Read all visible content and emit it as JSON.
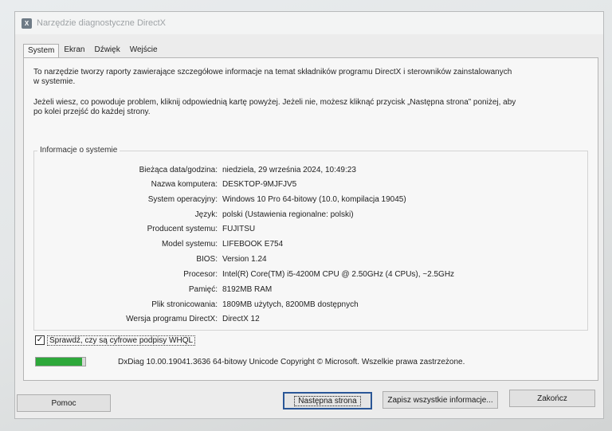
{
  "window": {
    "title": "Narzędzie diagnostyczne DirectX",
    "app_icon_glyph": "X"
  },
  "tabs": [
    {
      "label": "System",
      "active": true
    },
    {
      "label": "Ekran",
      "active": false
    },
    {
      "label": "Dźwięk",
      "active": false
    },
    {
      "label": "Wejście",
      "active": false
    }
  ],
  "intro": {
    "paragraph1": "To narzędzie tworzy raporty zawierające szczegółowe informacje na temat składników programu DirectX i sterowników zainstalowanych w systemie.",
    "paragraph2": "Jeżeli wiesz, co powoduje problem, kliknij odpowiednią kartę powyżej. Jeżeli nie, możesz kliknąć przycisk „Następna strona” poniżej, aby po kolei przejść do każdej strony."
  },
  "system_info": {
    "group_label": "Informacje o systemie",
    "rows": [
      {
        "key": "Bieżąca data/godzina:",
        "value": "niedziela, 29 września 2024, 10:49:23"
      },
      {
        "key": "Nazwa komputera:",
        "value": "DESKTOP-9MJFJV5"
      },
      {
        "key": "System operacyjny:",
        "value": "Windows 10 Pro 64-bitowy (10.0, kompilacja 19045)"
      },
      {
        "key": "Język:",
        "value": "polski (Ustawienia regionalne: polski)"
      },
      {
        "key": "Producent systemu:",
        "value": "FUJITSU"
      },
      {
        "key": "Model systemu:",
        "value": "LIFEBOOK E754"
      },
      {
        "key": "BIOS:",
        "value": "Version 1.24"
      },
      {
        "key": "Procesor:",
        "value": "Intel(R) Core(TM) i5-4200M CPU @ 2.50GHz (4 CPUs), ~2.5GHz"
      },
      {
        "key": "Pamięć:",
        "value": "8192MB RAM"
      },
      {
        "key": "Plik stronicowania:",
        "value": "1809MB użytych, 8200MB dostępnych"
      },
      {
        "key": "Wersja programu DirectX:",
        "value": "DirectX 12"
      }
    ]
  },
  "whql_check": {
    "label": "Sprawdź, czy są cyfrowe podpisy WHQL",
    "checked": true,
    "check_glyph": "✓"
  },
  "progress": {
    "fraction": 0.93,
    "color": "#2da83a"
  },
  "footer_text": "DxDiag 10.00.19041.3636 64-bitowy Unicode  Copyright © Microsoft. Wszelkie prawa zastrzeżone.",
  "buttons": {
    "help": "Pomoc",
    "next_page": "Następna strona",
    "save_all": "Zapisz wszystkie informacje...",
    "exit": "Zakończ"
  }
}
